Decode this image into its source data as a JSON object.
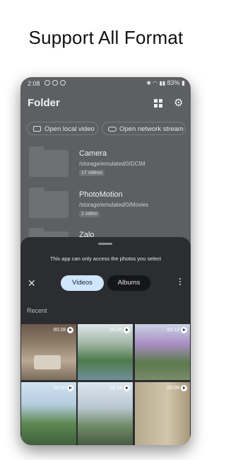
{
  "headline": "Support All Format",
  "status": {
    "time": "2:08",
    "battery": "83%"
  },
  "app": {
    "title": "Folder"
  },
  "chips": [
    {
      "label": "Open local video"
    },
    {
      "label": "Open network stream"
    }
  ],
  "folders": [
    {
      "name": "Camera",
      "path": "/storage/emulated/0/DCIM",
      "count": "17 videos"
    },
    {
      "name": "PhotoMotion",
      "path": "/storage/emulated/0/Movies",
      "count": "1 video"
    },
    {
      "name": "Zalo",
      "path": "",
      "count": ""
    }
  ],
  "sheet": {
    "notice": "This app can only access the photos you select",
    "tabs": [
      {
        "label": "Videos"
      },
      {
        "label": "Albums"
      }
    ],
    "recent_label": "Recent",
    "thumbnails": [
      {
        "duration": "00:28"
      },
      {
        "duration": "00:25"
      },
      {
        "duration": "00:13"
      },
      {
        "duration": "00:50"
      },
      {
        "duration": "00:14"
      },
      {
        "duration": "00:09"
      }
    ]
  },
  "icons": [
    "grid-icon",
    "gear-icon",
    "close-icon",
    "more-vert-icon",
    "play-icon",
    "folder-icon",
    "video-icon",
    "link-icon"
  ]
}
